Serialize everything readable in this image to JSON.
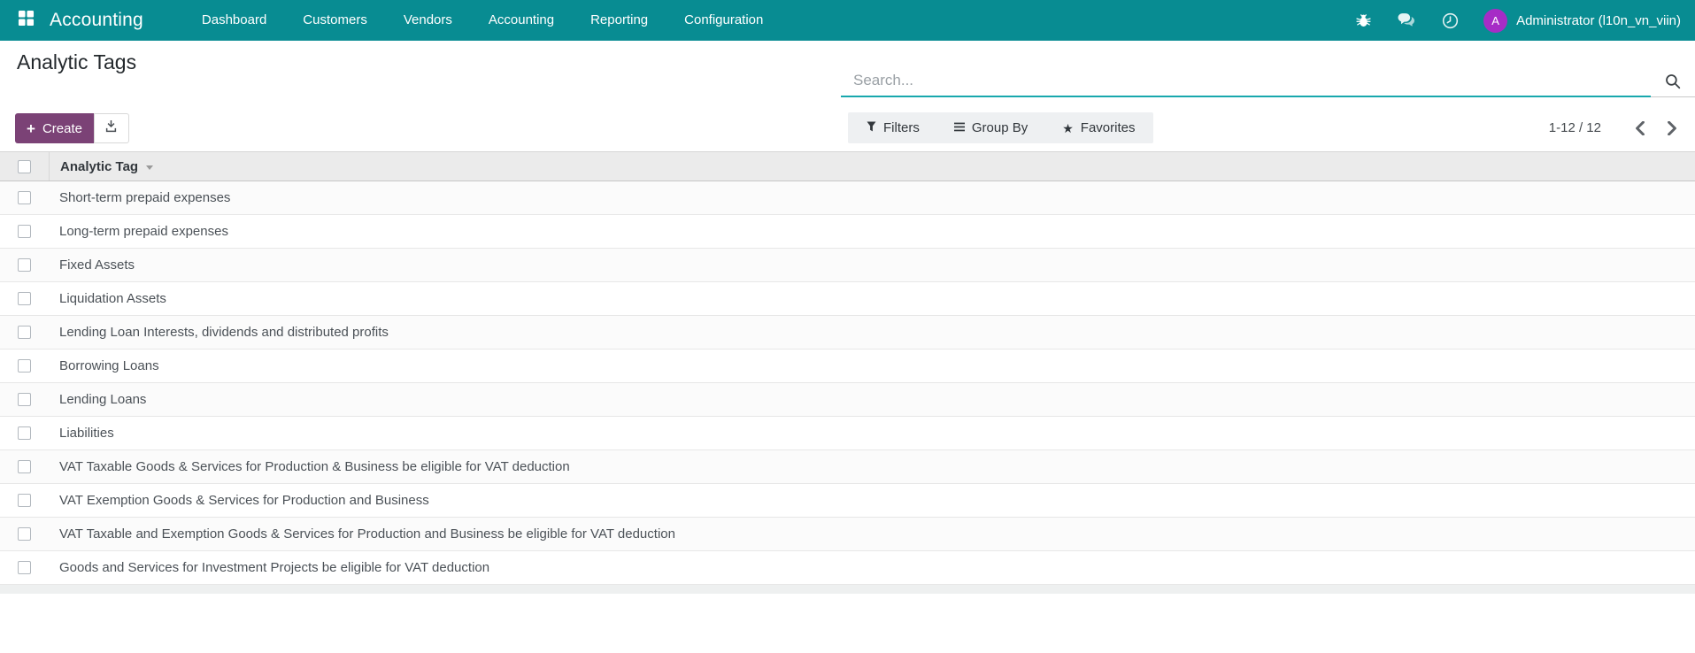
{
  "navbar": {
    "brand": "Accounting",
    "menu": [
      "Dashboard",
      "Customers",
      "Vendors",
      "Accounting",
      "Reporting",
      "Configuration"
    ],
    "icons": [
      "apps-grid-icon",
      "bug-icon",
      "chat-icon",
      "clock-icon"
    ],
    "user_name": "Administrator (l10n_vn_viin)",
    "avatar_initial": "A"
  },
  "control_panel": {
    "title": "Analytic Tags",
    "search": {
      "placeholder": "Search...",
      "value": "",
      "icon": "search-icon"
    },
    "buttons": {
      "create": "Create",
      "export_icon": "download-icon",
      "filters": "Filters",
      "group_by": "Group By",
      "favorites": "Favorites"
    },
    "pager": {
      "display": "1-12 / 12",
      "prev_icon": "chevron-left-icon",
      "next_icon": "chevron-right-icon"
    }
  },
  "table": {
    "column_header": "Analytic Tag",
    "rows": [
      "Short-term prepaid expenses",
      "Long-term prepaid expenses",
      "Fixed Assets",
      "Liquidation Assets",
      "Lending Loan Interests, dividends and distributed profits",
      "Borrowing Loans",
      "Lending Loans",
      "Liabilities",
      "VAT Taxable Goods & Services for Production & Business be eligible for VAT deduction",
      "VAT Exemption Goods & Services for Production and Business",
      "VAT Taxable and Exemption Goods & Services for Production and Business be eligible for VAT deduction",
      "Goods and Services for Investment Projects be eligible for VAT deduction"
    ]
  },
  "colors": {
    "navbar_bg": "#088c92",
    "search_underline": "#18a8ad",
    "create_button": "#7b4276",
    "avatar_bg": "#a62cc6",
    "table_header_bg": "#ebebeb"
  }
}
